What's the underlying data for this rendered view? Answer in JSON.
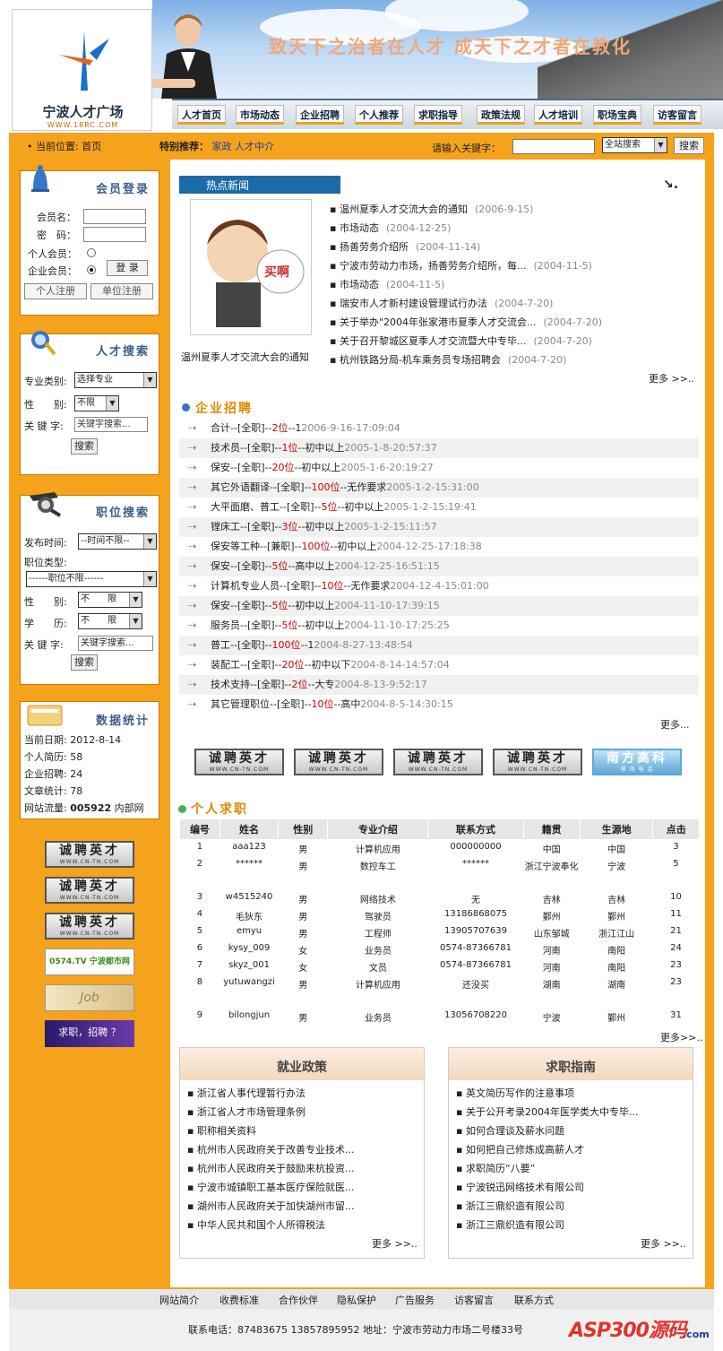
{
  "header": {
    "slogan": "致天下之治者在人才 成天下之才者在教化",
    "logo_name": "宁波人才广场",
    "logo_url": "WWW.18RC.COM",
    "nav": [
      "人才首页",
      "市场动态",
      "企业招聘",
      "个人推荐",
      "求职指导",
      "政策法规",
      "人才培训",
      "职场宝典",
      "访客留言"
    ]
  },
  "topbar": {
    "location_label": "当前位置:",
    "location_value": "首页",
    "special_label": "特别推荐：",
    "special_links": [
      "家政",
      "人才中介"
    ],
    "keyword_label": "请输入关键字：",
    "scope": "全站搜索",
    "search_button": "搜索"
  },
  "member": {
    "title": "会员登录",
    "username_label": "会员名：",
    "password_label": "密　码：",
    "personal_label": "个人会员：",
    "company_label": "企业会员：",
    "login_button": "登 录",
    "reg_personal": "个人注册",
    "reg_company": "单位注册"
  },
  "talent_search": {
    "title": "人才搜索",
    "major_label": "专业类别:",
    "major_value": "选择专业",
    "gender_label": "性　　别:",
    "gender_value": "不限",
    "keyword_label": "关 键 字:",
    "keyword_placeholder": "关键字搜索...",
    "button": "搜索"
  },
  "job_search": {
    "title": "职位搜索",
    "time_label": "发布时间:",
    "time_value": "--时间不限--",
    "type_label": "职位类型:",
    "type_value": "------职位不限------",
    "gender_label": "性　　别:",
    "gender_value": "不　　限",
    "edu_label": "学　　历:",
    "edu_value": "不　　限",
    "keyword_label": "关 键 字:",
    "keyword_placeholder": "关键字搜索...",
    "button": "搜索"
  },
  "stats": {
    "title": "数据统计",
    "rows": [
      {
        "label": "当前日期:",
        "value": "2012-8-14"
      },
      {
        "label": "个人简历:",
        "value": "58"
      },
      {
        "label": "企业招聘:",
        "value": "24"
      },
      {
        "label": "文章统计:",
        "value": "78"
      }
    ],
    "traffic_label": "网站流量:",
    "traffic_value": "005922",
    "traffic_suffix": "内部网"
  },
  "side_banners": {
    "cn_tn": "诚聘英才",
    "cn_tn_url": "WWW.CN-TN.COM",
    "city_text": "0574.TV 宁波都市网",
    "job_text": "Job",
    "qz_text": "求职，招聘 ？"
  },
  "hot_news": {
    "title": "热点新闻",
    "image_caption": "温州夏季人才交流大会的通知",
    "mascot_text": "买啊",
    "items": [
      {
        "title": "温州夏季人才交流大会的通知",
        "date": "(2006-9-15)"
      },
      {
        "title": "市场动态",
        "date": "(2004-12-25)"
      },
      {
        "title": "扬善劳务介绍所",
        "date": "(2004-11-14)"
      },
      {
        "title": "宁波市劳动力市场，扬善劳务介绍所，每...",
        "date": "(2004-11-5)"
      },
      {
        "title": "市场动态",
        "date": "(2004-11-5)"
      },
      {
        "title": "瑞安市人才新村建设管理试行办法",
        "date": "(2004-7-20)"
      },
      {
        "title": "关于举办\"2004年张家港市夏季人才交流会...",
        "date": "(2004-7-20)"
      },
      {
        "title": "关于召开黎城区夏季人才交流暨大中专毕...",
        "date": "(2004-7-20)"
      },
      {
        "title": "杭州铁路分局-机车乘务员专场招聘会",
        "date": "(2004-7-20)"
      }
    ],
    "more": "更多 >>.."
  },
  "recruit": {
    "title": "企业招聘",
    "rows": [
      {
        "name": "合计--[全职]--",
        "count": "2位",
        "req": "--1",
        "time": "2006-9-16-17:09:04"
      },
      {
        "name": "技术员--[全职]--",
        "count": "1位",
        "req": "--初中以上",
        "time": "2005-1-8-20:57:37"
      },
      {
        "name": "保安--[全职]--",
        "count": "20位",
        "req": "--初中以上",
        "time": "2005-1-6-20:19:27"
      },
      {
        "name": "其它外语翻译--[全职]--",
        "count": "100位",
        "req": "--无作要求",
        "time": "2005-1-2-15:31:00"
      },
      {
        "name": "大平面磨、普工--[全职]--",
        "count": "5位",
        "req": "--初中以上",
        "time": "2005-1-2-15:19:41"
      },
      {
        "name": "镗床工--[全职]--",
        "count": "3位",
        "req": "--初中以上",
        "time": "2005-1-2-15:11:57"
      },
      {
        "name": "保安等工种--[兼职]--",
        "count": "100位",
        "req": "--初中以上",
        "time": "2004-12-25-17:18:38"
      },
      {
        "name": "保安--[全职]--",
        "count": "5位",
        "req": "--高中以上",
        "time": "2004-12-25-16:51:15"
      },
      {
        "name": "计算机专业人员--[全职]--",
        "count": "10位",
        "req": "--无作要求",
        "time": "2004-12-4-15:01:00"
      },
      {
        "name": "保安--[全职]--",
        "count": "5位",
        "req": "--初中以上",
        "time": "2004-11-10-17:39:15"
      },
      {
        "name": "服务员--[全职]--",
        "count": "5位",
        "req": "--初中以上",
        "time": "2004-11-10-17:25:25"
      },
      {
        "name": "普工--[全职]--",
        "count": "100位",
        "req": "--1",
        "time": "2004-8-27-13:48:54"
      },
      {
        "name": "装配工--[全职]--",
        "count": "20位",
        "req": "--初中以下",
        "time": "2004-8-14-14:57:04"
      },
      {
        "name": "技术支持--[全职]--",
        "count": "2位",
        "req": "--大专",
        "time": "2004-8-13-9:52:17"
      },
      {
        "name": "其它管理职位--[全职]--",
        "count": "10位",
        "req": "--高中",
        "time": "2004-8-5-14:30:15"
      }
    ],
    "more": "更多..."
  },
  "mid_banners": {
    "cn_tn": "诚聘英才",
    "cn_tn_url": "WWW.CN-TN.COM",
    "south": "南方高科",
    "south_sub": "移 动 电 话"
  },
  "resumes": {
    "title": "个人求职",
    "headers": [
      "编号",
      "姓名",
      "性别",
      "专业介绍",
      "联系方式",
      "籍贯",
      "生源地",
      "点击"
    ],
    "rows": [
      [
        "1",
        "aaa123",
        "男",
        "计算机应用",
        "000000000",
        "中国",
        "中国",
        "3"
      ],
      [
        "2",
        "******",
        "男",
        "数控车工",
        "******",
        "浙江宁波奉化",
        "宁波",
        "5"
      ],
      [
        "3",
        "w4515240",
        "男",
        "网络技术",
        "无",
        "吉林",
        "吉林",
        "10"
      ],
      [
        "4",
        "毛狄东",
        "男",
        "驾驶员",
        "13186868075",
        "鄞州",
        "鄞州",
        "11"
      ],
      [
        "5",
        "emyu",
        "男",
        "工程师",
        "13905707639",
        "山东邹城",
        "浙江江山",
        "21"
      ],
      [
        "6",
        "kysy_009",
        "女",
        "业务员",
        "0574-87366781",
        "河南",
        "南阳",
        "24"
      ],
      [
        "7",
        "skyz_001",
        "女",
        "文员",
        "0574-87366781",
        "河南",
        "南阳",
        "23"
      ],
      [
        "8",
        "yutuwangzi",
        "男",
        "计算机应用",
        "还没买",
        "湖南",
        "湖南",
        "23"
      ],
      [
        "9",
        "bilongjun",
        "男",
        "业务员",
        "13056708220",
        "宁波",
        "鄞州",
        "31"
      ]
    ],
    "more": "更多>>.."
  },
  "policy": {
    "title": "就业政策",
    "items": [
      "浙江省人事代理暂行办法",
      "浙江省人才市场管理条例",
      "职称相关资料",
      "杭州市人民政府关于改善专业技术...",
      "杭州市人民政府关于鼓励来杭投资...",
      "宁波市城镇职工基本医疗保险就医...",
      "湖州市人民政府关于加快湖州市留...",
      "中华人民共和国个人所得税法"
    ],
    "more": "更多 >>.."
  },
  "guide": {
    "title": "求职指南",
    "items": [
      "英文简历写作的注意事项",
      "关于公开考录2004年医学类大中专毕...",
      "如何合理谈及薪水问题",
      "如何把自己修炼成高薪人才",
      "求职简历“八要”",
      "宁波锐迅网络技术有限公司",
      "浙江三鼎织造有限公司",
      "浙江三鼎织造有限公司"
    ],
    "more": "更多 >>.."
  },
  "footer": {
    "links": [
      "网站简介",
      "收费标准",
      "合作伙伴",
      "隐私保护",
      "广告服务",
      "访客留言",
      "联系方式"
    ],
    "info": "联系电话：87483675 13857895952 地址：宁波市劳动力市场二号楼33号",
    "watermark": "ASP300源码",
    "watermark_sub": ".com"
  },
  "colors": {
    "orange": "#f5a21c",
    "nav_accent": "#e8a41f",
    "link_blue": "#1f3f9f",
    "title_orange": "#e08a00",
    "red": "#c00"
  }
}
